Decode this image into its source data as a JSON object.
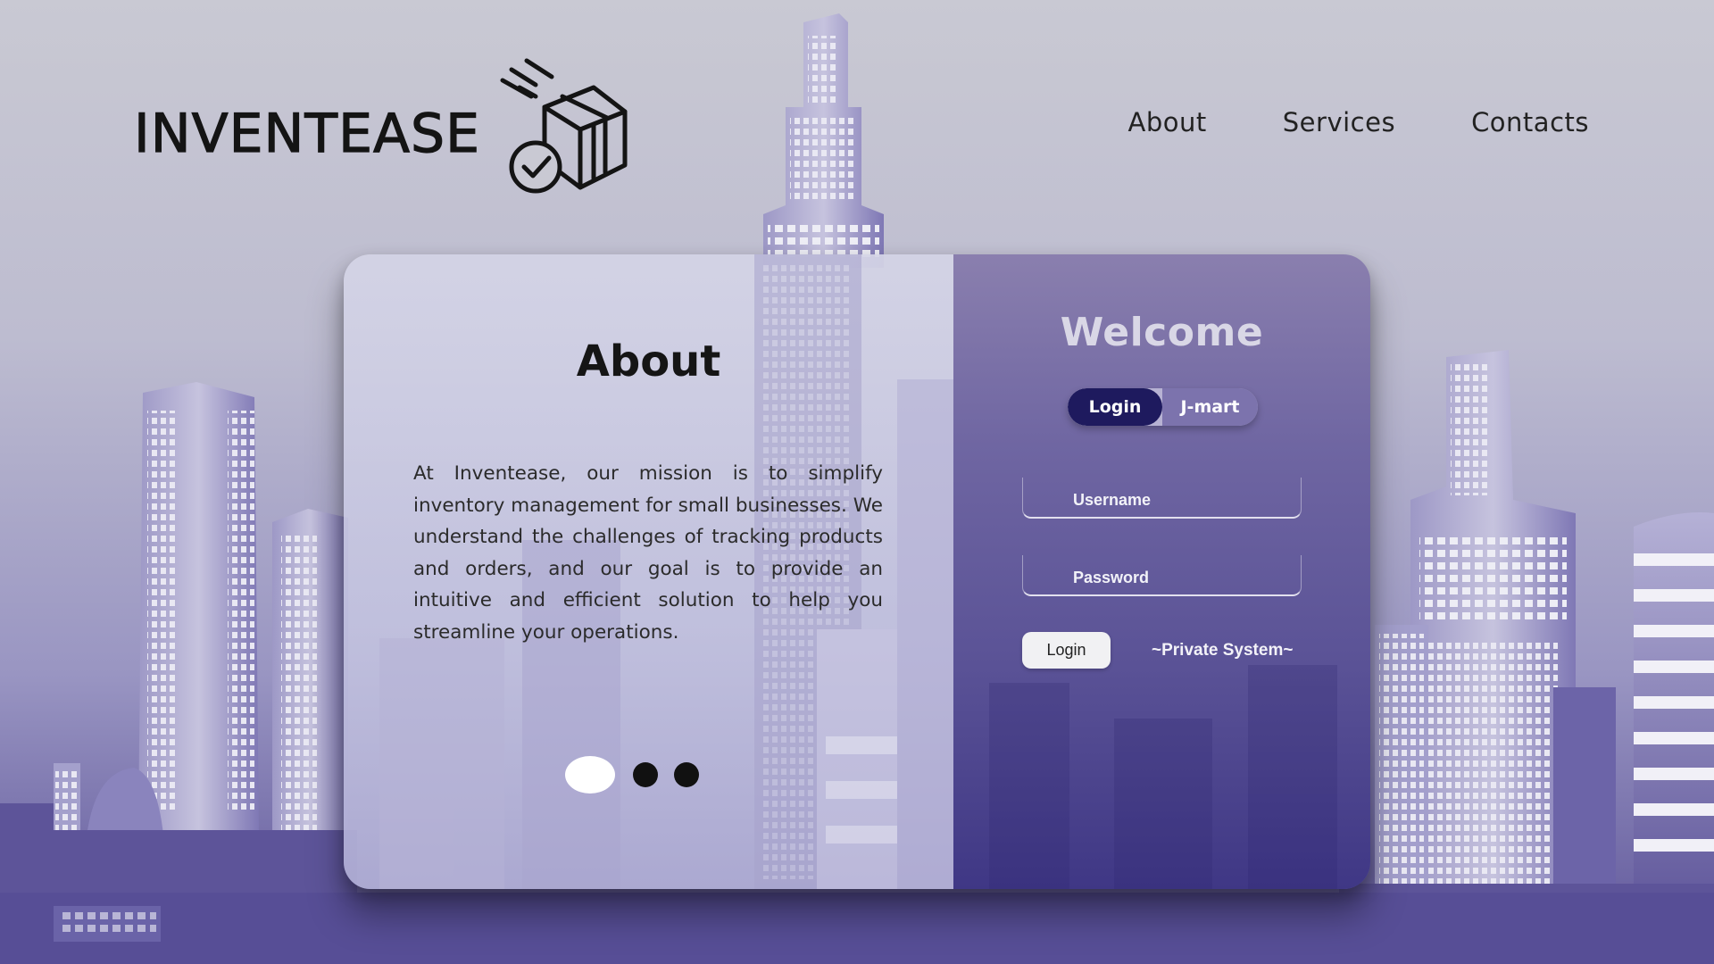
{
  "brand": {
    "name": "INVENTEASE"
  },
  "nav": {
    "items": [
      {
        "label": "About"
      },
      {
        "label": "Services"
      },
      {
        "label": "Contacts"
      }
    ]
  },
  "about": {
    "title": "About",
    "text": "At Inventease, our mission is to simplify inventory management for small businesses. We understand the challenges of tracking products and orders, and our goal is to provide an intuitive and efficient solution to help you streamline your operations.",
    "carousel": {
      "slides": 3,
      "active_index": 0
    }
  },
  "login": {
    "title": "Welcome",
    "toggle": {
      "active_label": "Login",
      "inactive_label": "J-mart"
    },
    "username": {
      "placeholder": "Username",
      "value": ""
    },
    "password": {
      "placeholder": "Password",
      "value": ""
    },
    "submit_label": "Login",
    "note": "~Private System~"
  },
  "colors": {
    "panel_dark": "#1e1a5e",
    "panel_right_top": "#8a7fae",
    "panel_right_bottom": "#3f3785",
    "skyline": "#5d5499"
  },
  "icons": {
    "logo": "box-check-icon"
  }
}
